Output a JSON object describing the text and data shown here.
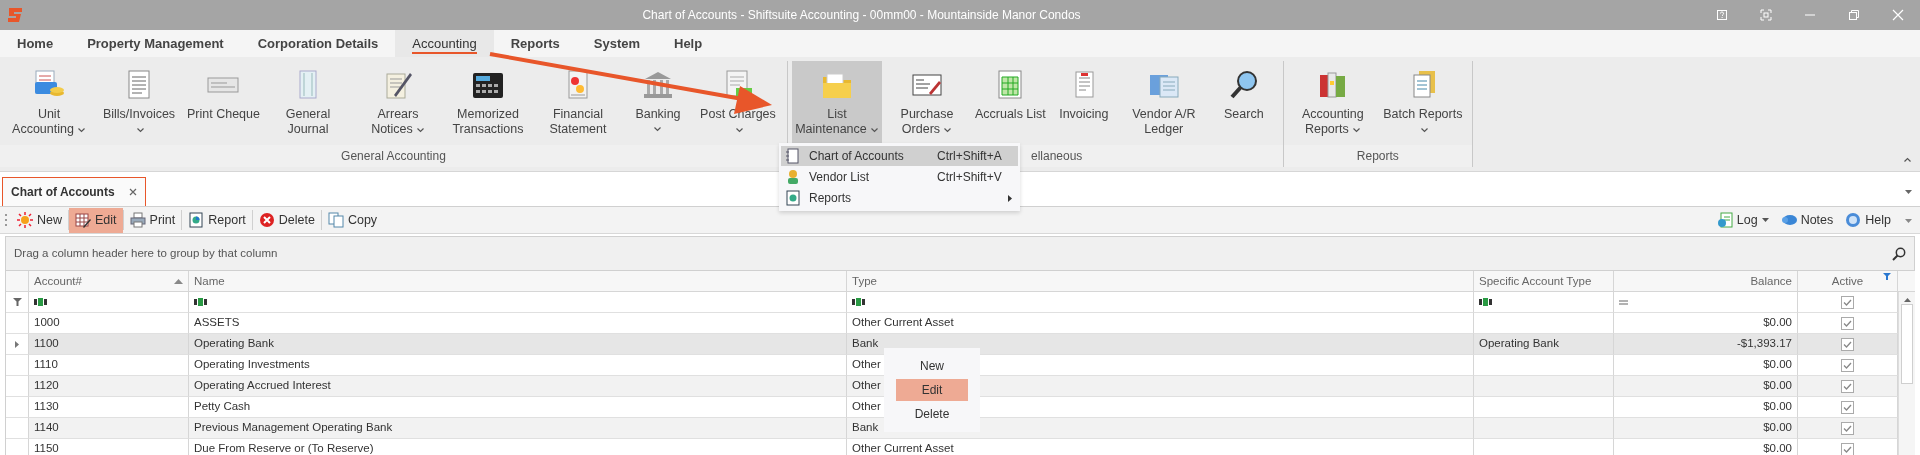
{
  "window": {
    "title": "Chart of Accounts - Shiftsuite Accounting - 00mm00 - Mountainside Manor Condos"
  },
  "menu_tabs": [
    {
      "label": "Home",
      "selected": false
    },
    {
      "label": "Property Management",
      "selected": false
    },
    {
      "label": "Corporation Details",
      "selected": false
    },
    {
      "label": "Accounting",
      "selected": true
    },
    {
      "label": "Reports",
      "selected": false
    },
    {
      "label": "System",
      "selected": false
    },
    {
      "label": "Help",
      "selected": false
    }
  ],
  "ribbon": {
    "groups": [
      {
        "label": "General Accounting",
        "items": [
          {
            "label": "Unit Accounting",
            "dropdown": true,
            "selected": false
          },
          {
            "label": "Bills/Invoices",
            "dropdown": true,
            "selected": false
          },
          {
            "label": "Print Cheque",
            "dropdown": false,
            "selected": false
          },
          {
            "label": "General Journal",
            "dropdown": false,
            "selected": false
          },
          {
            "label": "Arrears Notices",
            "dropdown": true,
            "selected": false
          },
          {
            "label": "Memorized Transactions",
            "dropdown": false,
            "selected": false
          },
          {
            "label": "Financial Statement",
            "dropdown": false,
            "selected": false
          },
          {
            "label": "Banking",
            "dropdown": true,
            "selected": false
          },
          {
            "label": "Post Charges",
            "dropdown": true,
            "selected": false
          }
        ]
      },
      {
        "label": "ellaneous",
        "items": [
          {
            "label": "List Maintenance",
            "dropdown": true,
            "selected": true
          },
          {
            "label": "Purchase Orders",
            "dropdown": true,
            "selected": false
          },
          {
            "label": "Accruals List",
            "dropdown": false,
            "selected": false
          },
          {
            "label": "Invoicing",
            "dropdown": false,
            "selected": false
          },
          {
            "label": "Vendor A/R Ledger",
            "dropdown": false,
            "selected": false
          },
          {
            "label": "Search",
            "dropdown": false,
            "selected": false
          }
        ]
      },
      {
        "label": "Reports",
        "items": [
          {
            "label": "Accounting Reports",
            "dropdown": true,
            "selected": false
          },
          {
            "label": "Batch Reports",
            "dropdown": true,
            "selected": false
          }
        ]
      }
    ]
  },
  "list_maintenance_menu": {
    "items": [
      {
        "label": "Chart of Accounts",
        "shortcut": "Ctrl+Shift+A",
        "submenu": false,
        "selected": true
      },
      {
        "label": "Vendor List",
        "shortcut": "Ctrl+Shift+V",
        "submenu": false,
        "selected": false
      },
      {
        "label": "Reports",
        "submenu": true,
        "selected": false
      }
    ]
  },
  "document_tabs": [
    {
      "label": "Chart of Accounts",
      "selected": true
    }
  ],
  "toolbar": {
    "left": [
      {
        "label": "New",
        "selected": false
      },
      {
        "label": "Edit",
        "selected": true
      },
      {
        "label": "Print",
        "selected": false
      },
      {
        "label": "Report",
        "selected": false
      },
      {
        "label": "Delete",
        "selected": false
      },
      {
        "label": "Copy",
        "selected": false
      }
    ],
    "right": [
      {
        "label": "Log",
        "dropdown": true
      },
      {
        "label": "Notes",
        "dropdown": false
      },
      {
        "label": "Help",
        "dropdown": false
      }
    ]
  },
  "group_panel": {
    "hint": "Drag a column header here to group by that column"
  },
  "table": {
    "columns": [
      {
        "label": "Account#",
        "sorted_ascending": true,
        "filtered": false
      },
      {
        "label": "Name",
        "sorted_ascending": false,
        "filtered": false
      },
      {
        "label": "Type",
        "sorted_ascending": false,
        "filtered": false
      },
      {
        "label": "Specific Account Type",
        "sorted_ascending": false,
        "filtered": false
      },
      {
        "label": "Balance",
        "sorted_ascending": false,
        "filtered": false
      },
      {
        "label": "Active",
        "sorted_ascending": false,
        "filtered": true
      }
    ],
    "filter_row": [
      {
        "kind": "text"
      },
      {
        "kind": "text"
      },
      {
        "kind": "text"
      },
      {
        "kind": "text"
      },
      {
        "kind": "number"
      },
      {
        "kind": "checkbox",
        "checked": true
      }
    ],
    "rows": [
      {
        "account": "1000",
        "name": "ASSETS",
        "type": "Other Current Asset",
        "balance": "$0.00",
        "active": true,
        "selected": false
      },
      {
        "account": "1100",
        "name": "Operating Bank",
        "type": "Bank",
        "specific_type": "Operating Bank",
        "balance": "-$1,393.17",
        "active": true,
        "selected": true
      },
      {
        "account": "1110",
        "name": "Operating Investments",
        "type": "Other",
        "balance": "$0.00",
        "active": true,
        "selected": false
      },
      {
        "account": "1120",
        "name": "Operating Accrued Interest",
        "type": "Other",
        "balance": "$0.00",
        "active": true,
        "selected": false
      },
      {
        "account": "1130",
        "name": "Petty Cash",
        "type": "Other",
        "balance": "$0.00",
        "active": true,
        "selected": false
      },
      {
        "account": "1140",
        "name": "Previous Management Operating Bank",
        "type": "Bank",
        "balance": "$0.00",
        "active": true,
        "selected": false
      },
      {
        "account": "1150",
        "name": "Due From Reserve or  (To Reserve)",
        "type": "Other Current Asset",
        "balance": "$0.00",
        "active": true,
        "selected": false
      }
    ]
  },
  "context_menu": {
    "items": [
      {
        "label": "New",
        "selected": false
      },
      {
        "label": "Edit",
        "selected": true
      },
      {
        "label": "Delete",
        "selected": false
      }
    ]
  }
}
